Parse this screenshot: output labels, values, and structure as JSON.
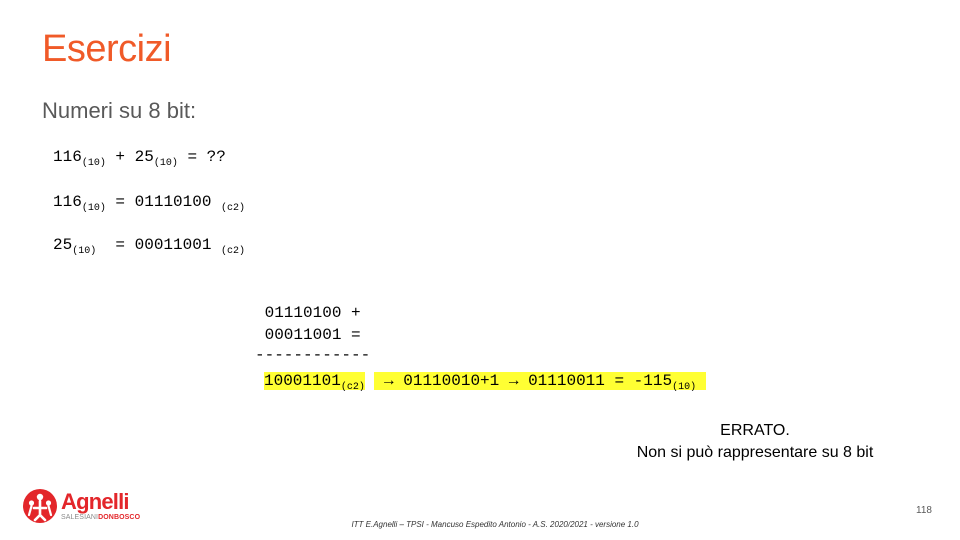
{
  "slide": {
    "title": "Esercizi",
    "subtitle": "Numeri su 8 bit:",
    "page_number": "118",
    "footer": "ITT E.Agnelli – TPSI  - Mancuso Espedito Antonio - A.S. 2020/2021  - versione 1.0"
  },
  "lines": {
    "l1": {
      "a": "116",
      "a_sub": "(10)",
      "b": " + 25",
      "b_sub": "(10)",
      "c": " = ??"
    },
    "l2": {
      "a": "116",
      "a_sub": "(10)",
      "b": " = 01110100 ",
      "b_sub": "(c2)"
    },
    "l3": {
      "a": "25",
      "a_sub": "(10)",
      "b": "  = 00011001 ",
      "b_sub": "(c2)"
    }
  },
  "sum": {
    "row1": " 01110100 +",
    "row2": " 00011001 =",
    "rule": "------------",
    "result": "10001101",
    "result_sub": "(c2)",
    "chain": " → 01110010+1 → 01110011 = -115",
    "chain_sub": "(10)"
  },
  "verdict": {
    "line1": "ERRATO.",
    "line2": "Non si può rappresentare su 8 bit"
  },
  "logo": {
    "name": "Agnelli",
    "sub1": "SALESIANI",
    "sub2": "DONBOSCO",
    "icon": "salesian-people-icon",
    "color": "#e3262a"
  },
  "colors": {
    "title": "#f05a28",
    "highlight": "#ffff33"
  }
}
